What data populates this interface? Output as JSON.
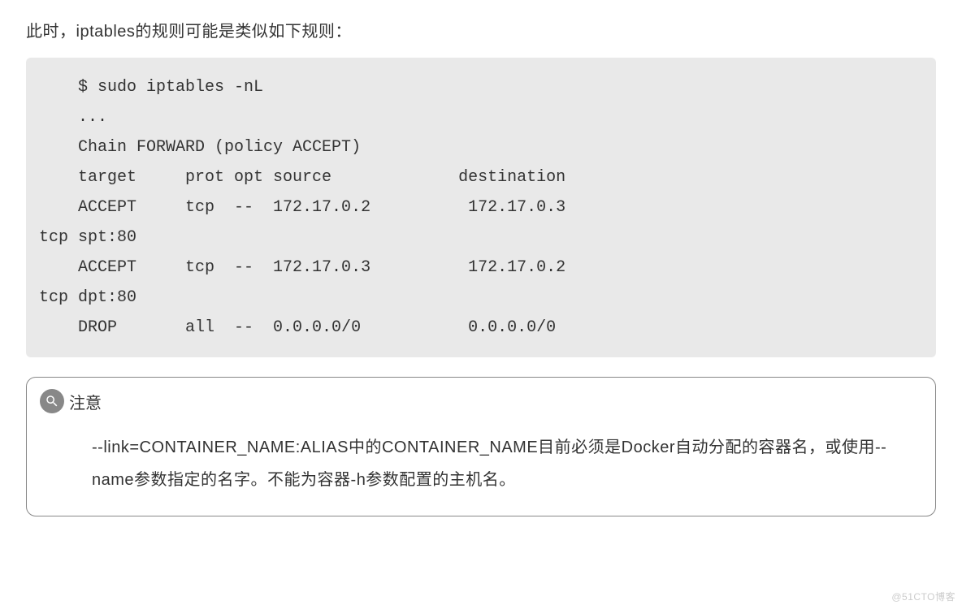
{
  "intro": "此时，iptables的规则可能是类似如下规则：",
  "code": "    $ sudo iptables -nL\n    ...\n    Chain FORWARD (policy ACCEPT)\n    target     prot opt source             destination\n    ACCEPT     tcp  --  172.17.0.2          172.17.0.3\ntcp spt:80\n    ACCEPT     tcp  --  172.17.0.3          172.17.0.2\ntcp dpt:80\n    DROP       all  --  0.0.0.0/0           0.0.0.0/0",
  "note": {
    "title": "注意",
    "body": "--link=CONTAINER_NAME:ALIAS中的CONTAINER_NAME目前必须是Docker自动分配的容器名，或使用--name参数指定的名字。不能为容器-h参数配置的主机名。"
  },
  "watermark": "@51CTO博客"
}
